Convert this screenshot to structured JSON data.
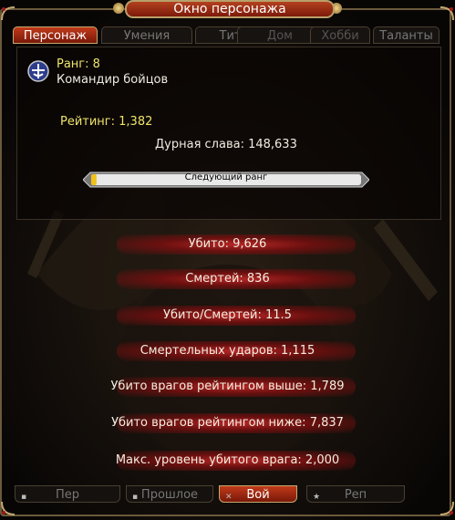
{
  "window": {
    "title": "Окно персонажа"
  },
  "tabs": [
    {
      "label": "Персонаж"
    },
    {
      "label": "Умения"
    },
    {
      "label": "Титул"
    },
    {
      "label": "Дом"
    },
    {
      "label": "Хобби"
    },
    {
      "label": "Таланты"
    }
  ],
  "rank": {
    "label": "Ранг: 8",
    "name": "Командир бойцов",
    "rating": "Рейтинг: 1,382",
    "infamy": "Дурная слава: 148,633",
    "next_rank_label": "Следующий ранг",
    "progress": 0.02,
    "icon": "rank-emblem-icon"
  },
  "stats": [
    {
      "text": "Убито:  9,626"
    },
    {
      "text": "Смертей:  836"
    },
    {
      "text": "Убито/Смертей:  11.5"
    },
    {
      "text": "Смертельных ударов:  1,115"
    },
    {
      "text": "Убито врагов рейтингом выше:  1,789"
    },
    {
      "text": "Убито врагов рейтингом ниже:  7,837"
    },
    {
      "text": "Макс. уровень убитого врага:  2,000"
    }
  ],
  "bottom_tabs": [
    {
      "label": "Пер",
      "icon": "page-icon"
    },
    {
      "label": "Прошлое",
      "icon": "scroll-icon"
    },
    {
      "label": "Вой",
      "icon": "swords-icon"
    },
    {
      "label": "Реп",
      "icon": "star-icon"
    }
  ],
  "colors": {
    "accent": "#b3411f",
    "gold": "#c5a870",
    "yellow_text": "#eee46a"
  }
}
